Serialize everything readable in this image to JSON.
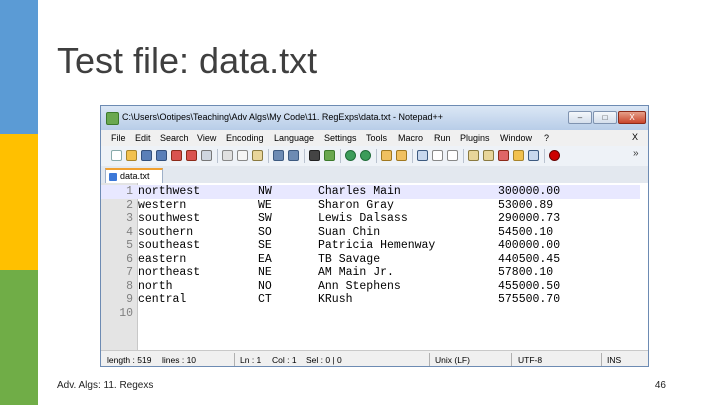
{
  "slide": {
    "title": "Test file: data.txt",
    "footer_left": "Adv. Algs: 11. Regexs",
    "page_number": "46"
  },
  "window": {
    "title": "C:\\Users\\Ootipes\\Teaching\\Adv Algs\\My Code\\11. RegExps\\data.txt - Notepad++",
    "buttons": {
      "minimize": "–",
      "maximize": "□",
      "close": "X"
    }
  },
  "menu": {
    "items": [
      "File",
      "Edit",
      "Search",
      "View",
      "Encoding",
      "Language",
      "Settings",
      "Tools",
      "Macro",
      "Run",
      "Plugins",
      "Window",
      "?"
    ],
    "close_doc": "X"
  },
  "toolbar": {
    "icons": [
      "new-file-icon",
      "open-file-icon",
      "save-icon",
      "save-all-icon",
      "close-icon",
      "close-all-icon",
      "print-icon",
      "cut-icon",
      "copy-icon",
      "paste-icon",
      "undo-icon",
      "redo-icon",
      "find-icon",
      "replace-icon",
      "zoom-in-icon",
      "zoom-out-icon",
      "sync-v-icon",
      "sync-h-icon",
      "word-wrap-icon",
      "all-chars-icon",
      "indent-guide-icon",
      "lang-icon",
      "doc-map-icon",
      "func-list-icon",
      "folder-icon",
      "monitor-icon",
      "record-macro-icon"
    ],
    "overflow": "»"
  },
  "tab": {
    "label": "data.txt"
  },
  "editor": {
    "lines": [
      {
        "n": "1",
        "region": "northwest",
        "code": "NW",
        "name": "Charles Main",
        "amount": "300000.00"
      },
      {
        "n": "2",
        "region": "western",
        "code": "WE",
        "name": "Sharon Gray",
        "amount": "53000.89"
      },
      {
        "n": "3",
        "region": "southwest",
        "code": "SW",
        "name": "Lewis Dalsass",
        "amount": "290000.73"
      },
      {
        "n": "4",
        "region": "southern",
        "code": "SO",
        "name": "Suan Chin",
        "amount": "54500.10"
      },
      {
        "n": "5",
        "region": "southeast",
        "code": "SE",
        "name": "Patricia Hemenway",
        "amount": "400000.00"
      },
      {
        "n": "6",
        "region": "eastern",
        "code": "EA",
        "name": "TB Savage",
        "amount": "440500.45"
      },
      {
        "n": "7",
        "region": "northeast",
        "code": "NE",
        "name": "AM Main Jr.",
        "amount": "57800.10"
      },
      {
        "n": "8",
        "region": "north",
        "code": "NO",
        "name": "Ann Stephens",
        "amount": "455000.50"
      },
      {
        "n": "9",
        "region": "central",
        "code": "CT",
        "name": "KRush",
        "amount": "575500.70"
      },
      {
        "n": "10",
        "region": "",
        "code": "",
        "name": "",
        "amount": ""
      }
    ]
  },
  "statusbar": {
    "length": "length : 519",
    "lines": "lines : 10",
    "ln": "Ln : 1",
    "col": "Col : 1",
    "sel": "Sel : 0 | 0",
    "eol": "Unix (LF)",
    "encoding": "UTF-8",
    "mode": "INS"
  }
}
